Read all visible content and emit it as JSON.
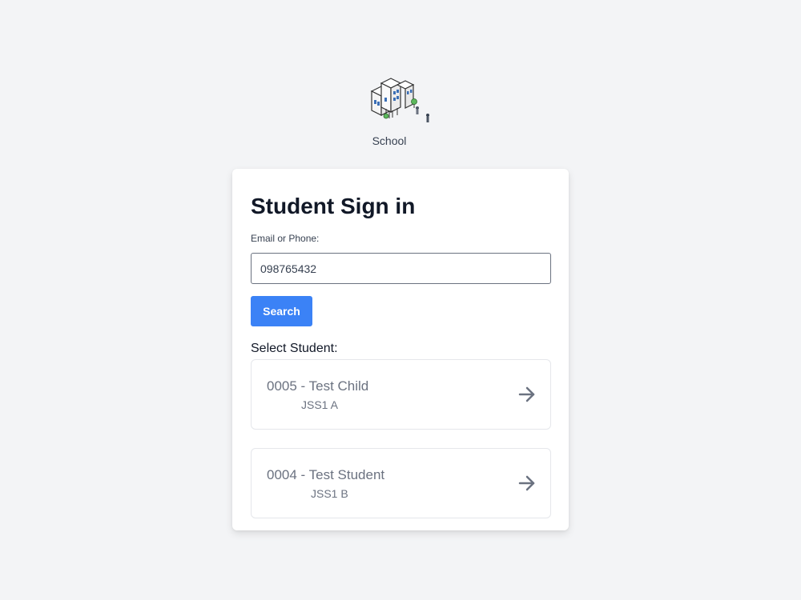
{
  "brand": {
    "name": "School",
    "logo_icon": "school-building-icon"
  },
  "signin": {
    "title": "Student Sign in",
    "field_label": "Email or Phone:",
    "field_value": "098765432",
    "search_label": "Search",
    "select_label": "Select Student:"
  },
  "students": [
    {
      "name": "0005 - Test Child",
      "class": "JSS1 A",
      "icon": "arrow-right-icon"
    },
    {
      "name": "0004 - Test Student",
      "class": "JSS1 B",
      "icon": "arrow-right-icon"
    }
  ],
  "colors": {
    "background": "#f3f4f6",
    "primary": "#3b82f6",
    "muted_text": "#6b7280"
  }
}
